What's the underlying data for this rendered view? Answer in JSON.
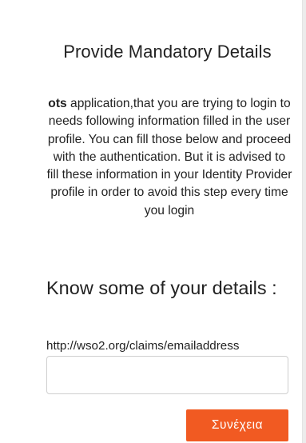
{
  "form": {
    "title": "Provide Mandatory Details",
    "intro_app_name": "ots",
    "intro_text": " application,that you are trying to login to needs following information filled in the user profile. You can fill those below and proceed with the authentication. But it is advised to fill these information in your Identity Provider profile in order to avoid this step every time you login",
    "section_heading": "Know some of your details :",
    "fields": [
      {
        "label": "http://wso2.org/claims/emailaddress",
        "value": "",
        "placeholder": ""
      }
    ],
    "submit_label": "Συνέχεια"
  },
  "colors": {
    "accent": "#f15a22",
    "text": "#222222",
    "background": "#ffffff",
    "input_border": "#cfcfcf"
  }
}
